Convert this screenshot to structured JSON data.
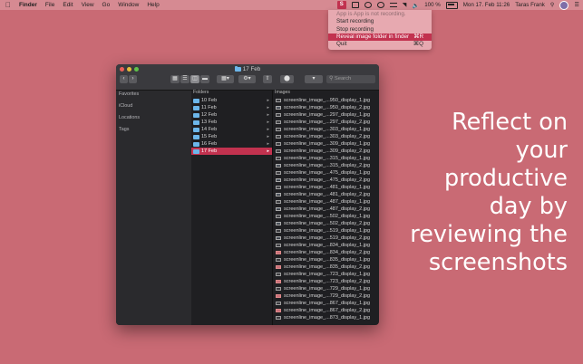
{
  "menubar": {
    "apple_icon": "apple-icon",
    "app_name": "Finder",
    "items": [
      "File",
      "Edit",
      "View",
      "Go",
      "Window",
      "Help"
    ],
    "status": {
      "app_badge": "S",
      "battery": "100 %",
      "datetime": "Mon 17. Feb 11:26",
      "user": "Taras Frank"
    }
  },
  "dropdown": {
    "status_text": "App is App is not recording.",
    "items": [
      {
        "label": "Start recording",
        "shortcut": ""
      },
      {
        "label": "Stop recording",
        "shortcut": ""
      },
      {
        "label": "Reveal image folder in finder",
        "shortcut": "⌘R"
      },
      {
        "label": "Quit",
        "shortcut": "⌘Q"
      }
    ],
    "highlighted_index": 2
  },
  "finder": {
    "title": "17 Feb",
    "sidebar": {
      "favorites": "Favorites",
      "icloud": "iCloud",
      "locations": "Locations",
      "tags": "Tags"
    },
    "folders_header": "Folders",
    "images_header": "Images",
    "folders": [
      "10 Feb",
      "11 Feb",
      "12 Feb",
      "13 Feb",
      "14 Feb",
      "15 Feb",
      "16 Feb",
      "17 Feb"
    ],
    "selected_folder": "17 Feb",
    "images": [
      "screenline_image_...950_display_1.jpg",
      "screenline_image_...950_display_2.jpg",
      "screenline_image_...297_display_1.jpg",
      "screenline_image_...297_display_2.jpg",
      "screenline_image_...303_display_1.jpg",
      "screenline_image_...303_display_2.jpg",
      "screenline_image_...309_display_1.jpg",
      "screenline_image_...309_display_2.jpg",
      "screenline_image_...315_display_1.jpg",
      "screenline_image_...315_display_2.jpg",
      "screenline_image_...475_display_1.jpg",
      "screenline_image_...475_display_2.jpg",
      "screenline_image_...481_display_1.jpg",
      "screenline_image_...481_display_2.jpg",
      "screenline_image_...487_display_1.jpg",
      "screenline_image_...487_display_2.jpg",
      "screenline_image_...502_display_1.jpg",
      "screenline_image_...502_display_2.jpg",
      "screenline_image_...519_display_1.jpg",
      "screenline_image_...519_display_2.jpg",
      "screenline_image_...834_display_1.jpg",
      "screenline_image_...834_display_2.jpg",
      "screenline_image_...835_display_1.jpg",
      "screenline_image_...835_display_2.jpg",
      "screenline_image_...723_display_1.jpg",
      "screenline_image_...723_display_2.jpg",
      "screenline_image_...729_display_1.jpg",
      "screenline_image_...729_display_2.jpg",
      "screenline_image_...867_display_1.jpg",
      "screenline_image_...867_display_2.jpg",
      "screenline_image_...873_display_1.jpg"
    ],
    "thumb_styles": [
      "dark",
      "img",
      "dark",
      "dark",
      "dark",
      "dark",
      "dark",
      "dark",
      "dark",
      "img",
      "dark",
      "img",
      "dark",
      "img",
      "dark",
      "img",
      "dark",
      "img",
      "dark",
      "img",
      "dark",
      "pink",
      "dark",
      "pink",
      "dark",
      "pink",
      "dark",
      "pink",
      "dark",
      "pink",
      "dark"
    ]
  },
  "headline": [
    "Reflect on",
    "your",
    "productive",
    "day by",
    "reviewing the",
    "screenshots"
  ],
  "colors": {
    "background": "#c96a74",
    "accent": "#c2324f",
    "folder_blue": "#6cb6ea"
  }
}
